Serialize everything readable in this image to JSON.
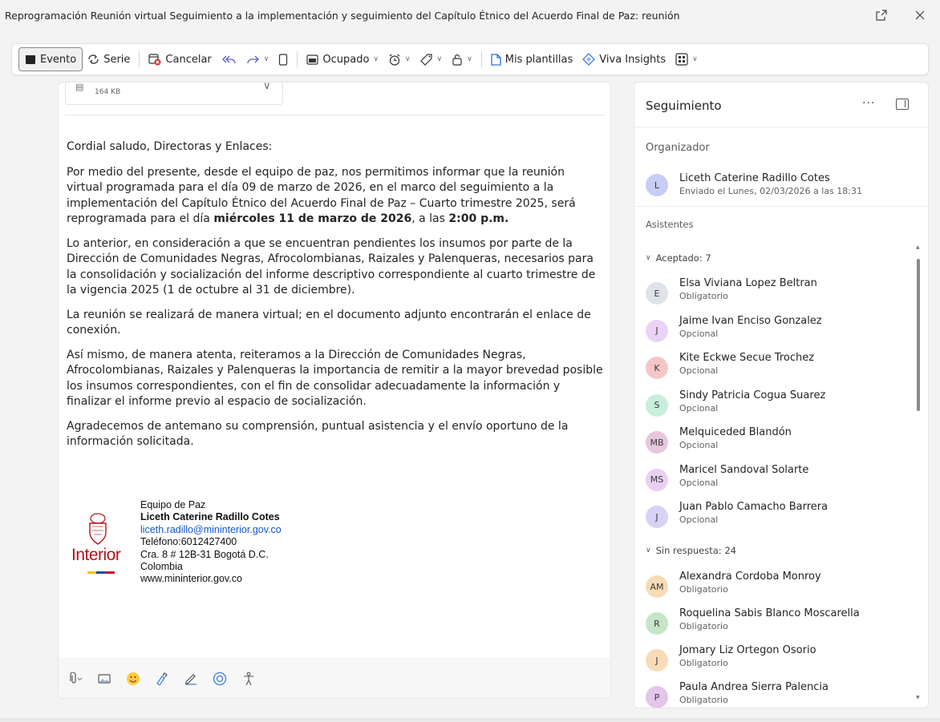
{
  "window": {
    "title": "Reprogramación Reunión virtual Seguimiento a la implementación y seguimiento del Capítulo Étnico del Acuerdo Final de Paz: reunión",
    "popout_icon": "popout-icon",
    "close_icon": "close-icon"
  },
  "toolbar": {
    "evento": "Evento",
    "serie": "Serie",
    "cancelar": "Cancelar",
    "ocupado": "Ocupado",
    "plantillas": "Mis plantillas",
    "viva": "Viva Insights"
  },
  "attachment": {
    "size": "164 KB"
  },
  "message": {
    "greeting": "Cordial saludo, Directoras y Enlaces:",
    "p1_a": "Por medio del presente, desde el equipo de paz, nos permitimos informar que la reunión virtual programada para el día 09 de marzo de 2026, en el marco del seguimiento a la implementación del Capítulo Étnico del Acuerdo Final de Paz – Cuarto trimestre 2025, será reprogramada para el día ",
    "p1_b": "miércoles",
    "p1_c": " 11 ",
    "p1_d": "de marzo de 2026",
    "p1_e": ", a las ",
    "p1_f": "2:00 p.m.",
    "p2": "Lo anterior, en consideración a que se encuentran pendientes los insumos por parte de la Dirección de Comunidades Negras, Afrocolombianas, Raizales y Palenqueras, necesarios para la consolidación y socialización del informe descriptivo correspondiente al cuarto trimestre de la vigencia 2025 (1 de octubre al 31 de diciembre).",
    "p3": "La reunión se realizará de manera virtual; en el documento adjunto encontrarán el enlace de conexión.",
    "p4": "Así mismo, de manera atenta, reiteramos a la Dirección de Comunidades Negras, Afrocolombianas, Raizales y Palenqueras la importancia de remitir a la mayor brevedad posible los insumos correspondientes, con el fin de consolidar adecuadamente la información y finalizar el informe previo al espacio de socialización.",
    "p5": "Agradecemos de antemano su comprensión, puntual asistencia y el envío oportuno de la información solicitada."
  },
  "signature": {
    "brand": "Interior",
    "team": "Equipo de Paz",
    "name": "Liceth Caterine Radillo Cotes",
    "email": "liceth.radillo@mininterior.gov.co",
    "phone": "Teléfono:6012427400",
    "address": "Cra. 8 # 12B-31 Bogotá D.C.",
    "country": "Colombia",
    "web": "www.mininterior.gov.co",
    "flag_colors": [
      "#f2c500",
      "#1f4aa8",
      "#c8102e"
    ]
  },
  "tracking": {
    "title": "Seguimiento",
    "organizer_label": "Organizador",
    "organizer": {
      "initials": "L",
      "name": "Liceth Caterine Radillo Cotes",
      "sent": "Enviado el Lunes, 02/03/2026 a las 18:31",
      "color": "#c7cdf5"
    },
    "attendees_label": "Asistentes",
    "accepted_label": "Aceptado: 7",
    "accepted": [
      {
        "initials": "E",
        "name": "Elsa Viviana Lopez Beltran",
        "role": "Obligatorio",
        "color": "#dde3e8"
      },
      {
        "initials": "J",
        "name": "Jaime Ivan Enciso Gonzalez",
        "role": "Opcional",
        "color": "#ead4f6"
      },
      {
        "initials": "K",
        "name": "Kite Eckwe Secue Trochez",
        "role": "Opcional",
        "color": "#f5c6c8"
      },
      {
        "initials": "S",
        "name": "Sindy Patricia Cogua Suarez",
        "role": "Opcional",
        "color": "#c8efdc"
      },
      {
        "initials": "MB",
        "name": "Melquiceded Blandón",
        "role": "Opcional",
        "color": "#e6c7dc"
      },
      {
        "initials": "MS",
        "name": "Maricel Sandoval Solarte",
        "role": "Opcional",
        "color": "#e9d0f2"
      },
      {
        "initials": "J",
        "name": "Juan Pablo Camacho Barrera",
        "role": "Opcional",
        "color": "#d6d3f5"
      }
    ],
    "noreply_label": "Sin respuesta: 24",
    "noreply": [
      {
        "initials": "AM",
        "name": "Alexandra Cordoba Monroy",
        "role": "Obligatorio",
        "color": "#f8dcb8"
      },
      {
        "initials": "R",
        "name": "Roquelina Sabis Blanco Moscarella",
        "role": "Obligatorio",
        "color": "#c5e6c8"
      },
      {
        "initials": "J",
        "name": "Jomary Liz Ortegon Osorio",
        "role": "Obligatorio",
        "color": "#f8dcb8"
      },
      {
        "initials": "P",
        "name": "Paula Andrea Sierra Palencia",
        "role": "Obligatorio",
        "color": "#e3c6ea"
      }
    ]
  }
}
